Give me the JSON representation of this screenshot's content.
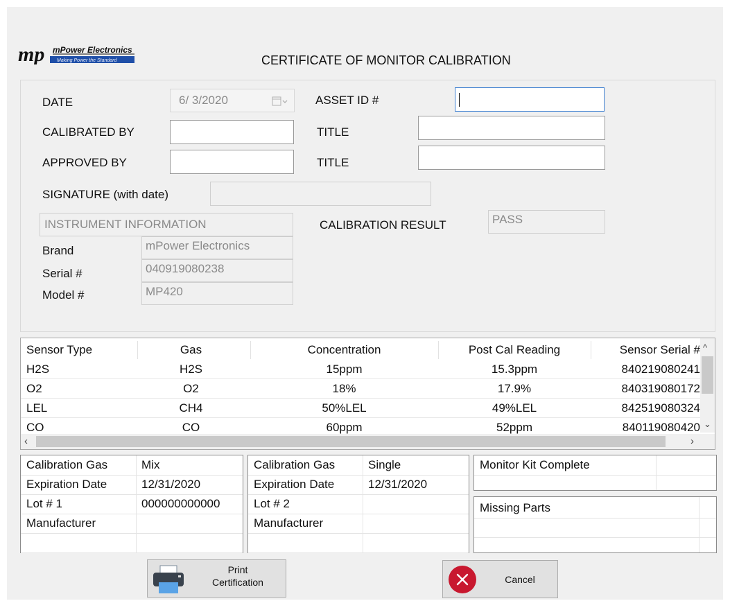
{
  "logo": {
    "brand_text": "mPower Electronics",
    "tagline": "Making Power the Standard",
    "letters": "mp"
  },
  "title": "CERTIFICATE OF MONITOR CALIBRATION",
  "form": {
    "date_label": "DATE",
    "date_value": "6/ 3/2020",
    "asset_id_label": "ASSET ID #",
    "asset_id_value": "",
    "calibrated_by_label": "CALIBRATED BY",
    "calibrated_by_value": "",
    "title_label_1": "TITLE",
    "title_value_1": "",
    "approved_by_label": "APPROVED BY",
    "approved_by_value": "",
    "title_label_2": "TITLE",
    "title_value_2": "",
    "signature_label": "SIGNATURE (with date)",
    "signature_value": ""
  },
  "instrument": {
    "header": "INSTRUMENT INFORMATION",
    "brand_label": "Brand",
    "brand_value": "mPower Electronics",
    "serial_label": "Serial #",
    "serial_value": "040919080238",
    "model_label": "Model #",
    "model_value": "MP420"
  },
  "calibration_result": {
    "label": "CALIBRATION RESULT",
    "value": "PASS"
  },
  "sensors": {
    "columns": [
      "Sensor Type",
      "Gas",
      "Concentration",
      "Post Cal Reading",
      "Sensor Serial #"
    ],
    "rows": [
      [
        "H2S",
        "H2S",
        "15ppm",
        "15.3ppm",
        "840219080241"
      ],
      [
        "O2",
        "O2",
        "18%",
        "17.9%",
        "840319080172"
      ],
      [
        "LEL",
        "CH4",
        "50%LEL",
        "49%LEL",
        "842519080324"
      ],
      [
        "CO",
        "CO",
        "60ppm",
        "52ppm",
        "840119080420"
      ]
    ]
  },
  "gas1": {
    "rows": [
      [
        "Calibration Gas",
        "Mix"
      ],
      [
        "Expiration Date",
        "12/31/2020"
      ],
      [
        "Lot # 1",
        "000000000000"
      ],
      [
        "Manufacturer",
        ""
      ],
      [
        "",
        ""
      ]
    ]
  },
  "gas2": {
    "rows": [
      [
        "Calibration Gas",
        "Single"
      ],
      [
        "Expiration Date",
        "12/31/2020"
      ],
      [
        "Lot # 2",
        ""
      ],
      [
        "Manufacturer",
        ""
      ],
      [
        "",
        ""
      ]
    ]
  },
  "kit": {
    "header": "Monitor Kit Complete"
  },
  "missing": {
    "header": "Missing Parts"
  },
  "buttons": {
    "print_line1": "Print",
    "print_line2": "Certification",
    "cancel": "Cancel"
  },
  "colors": {
    "logo_blue": "#1f4fa8",
    "cancel_red": "#c8182f",
    "focus_blue": "#3c7fd0"
  }
}
